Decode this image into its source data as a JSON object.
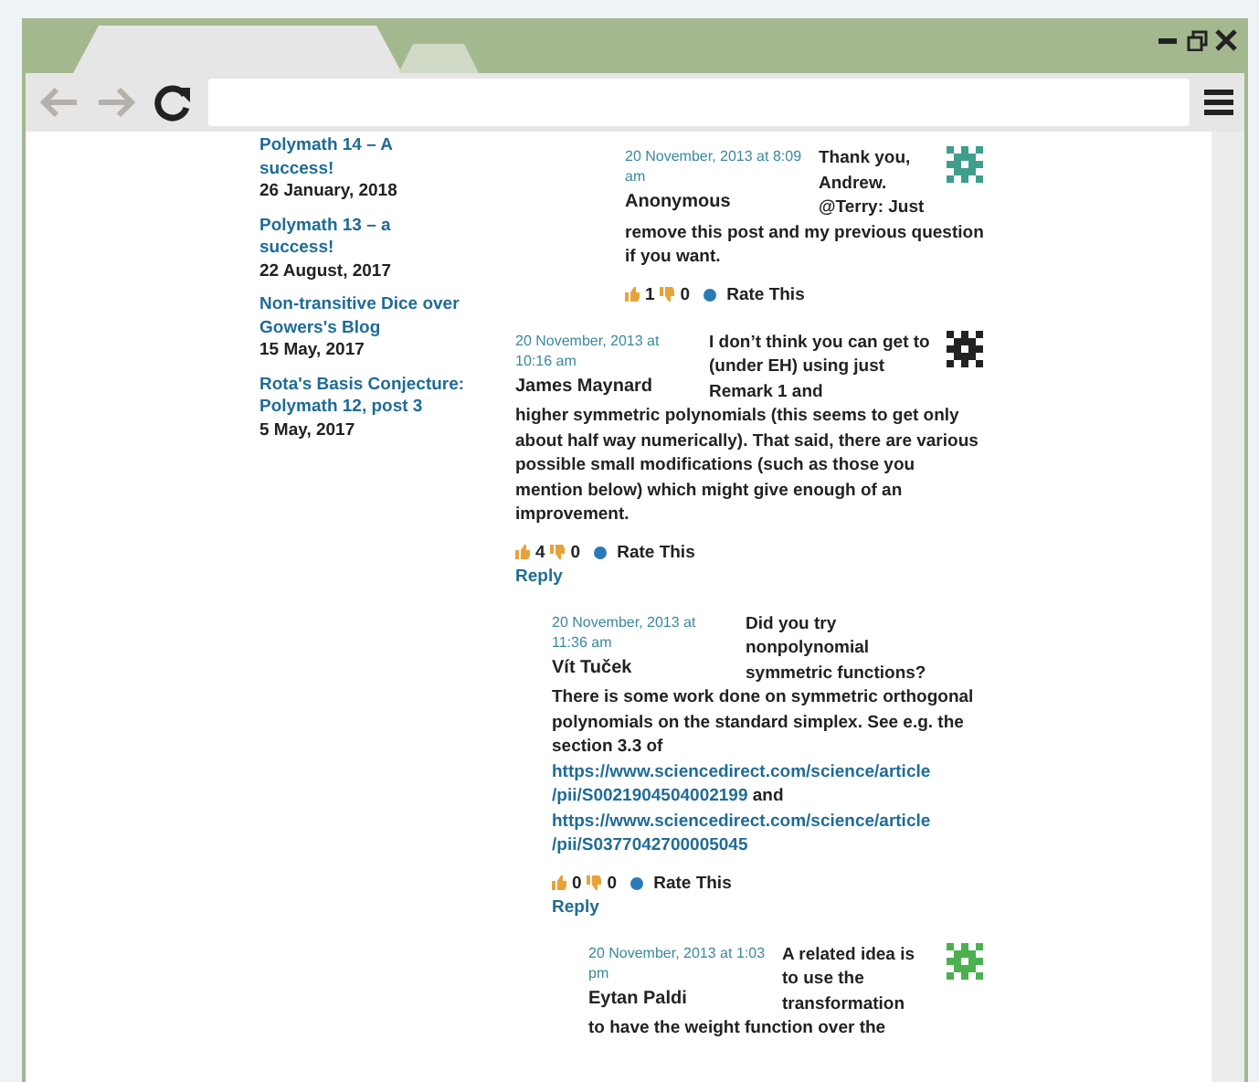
{
  "browser": {
    "tabs": [
      {
        "selected": true
      },
      {
        "selected": false
      }
    ]
  },
  "sidebar": {
    "posts": [
      {
        "title": "Polymath 14 – A success!",
        "date": "26 January, 2018"
      },
      {
        "title": "Polymath 13 – a success!",
        "date": "22 August, 2017"
      },
      {
        "title": "Non-transitive Dice over Gowers's Blog",
        "date": "15 May, 2017"
      },
      {
        "title": "Rota's Basis Conjecture: Polymath 12, post 3",
        "date": "5 May, 2017"
      }
    ]
  },
  "comments": [
    {
      "children": [
        {
          "children": [
            {
              "children": [
                {
                  "date": "20 November, 2013 at 8:09 am",
                  "author": "Anonymous",
                  "avatar": {
                    "color": "#3f9e8c"
                  },
                  "lead": [
                    [
                      {
                        "kind": "text",
                        "text": "Thank you, Andrew."
                      }
                    ],
                    [
                      {
                        "kind": "text",
                        "text": "@Terry: Just"
                      }
                    ]
                  ],
                  "rest": [
                    [
                      {
                        "kind": "text",
                        "text": "remove this post and my previous question if you want."
                      }
                    ]
                  ],
                  "likes": "1",
                  "dislikes": "0",
                  "rate": "Rate This"
                }
              ]
            }
          ]
        }
      ]
    },
    {
      "date": "20 November, 2013 at 10:16 am",
      "author": "James Maynard",
      "avatar": {
        "color": "#222222"
      },
      "lead": [
        [
          {
            "kind": "text",
            "text": "I don’t think you can get to       (under EH) using just Remark 1 and"
          }
        ]
      ],
      "rest": [
        [
          {
            "kind": "text",
            "text": "higher symmetric polynomials (this seems to get only about half way numerically). That said, there are various possible small modifications (such as those you mention below) which might give enough of an improvement."
          }
        ]
      ],
      "likes": "4",
      "dislikes": "0",
      "rate": "Rate This",
      "reply": "Reply",
      "children": [
        {
          "date": "20 November, 2013 at 11:36 am",
          "author": "Vít Tuček",
          "lead": [
            [
              {
                "kind": "text",
                "text": "Did you try nonpolynomial symmetric functions?"
              }
            ]
          ],
          "rest": [
            [
              {
                "kind": "text",
                "text": "There is some work done on symmetric orthogonal polynomials on the standard simplex. See e.g. the section 3.3 of "
              },
              {
                "kind": "link",
                "text": "https://www.sciencedirect.com/science/article"
              },
              {
                "kind": "link",
                "text": "/pii/S0021904504002199"
              },
              {
                "kind": "text",
                "text": " and "
              },
              {
                "kind": "link",
                "text": "https://www.sciencedirect.com/science/article"
              },
              {
                "kind": "link",
                "text": "/pii/S0377042700005045"
              }
            ]
          ],
          "likes": "0",
          "dislikes": "0",
          "rate": "Rate This",
          "reply": "Reply",
          "children": [
            {
              "date": "20 November, 2013 at 1:03 pm",
              "author": "Eytan Paldi",
              "avatar": {
                "color": "#4caf50"
              },
              "lead": [
                [
                  {
                    "kind": "text",
                    "text": "A related idea is to use the transformation"
                  }
                ]
              ],
              "rest": [
                [
                  {
                    "kind": "text",
                    "text": "to have the weight function over the"
                  }
                ]
              ]
            }
          ]
        }
      ]
    }
  ]
}
